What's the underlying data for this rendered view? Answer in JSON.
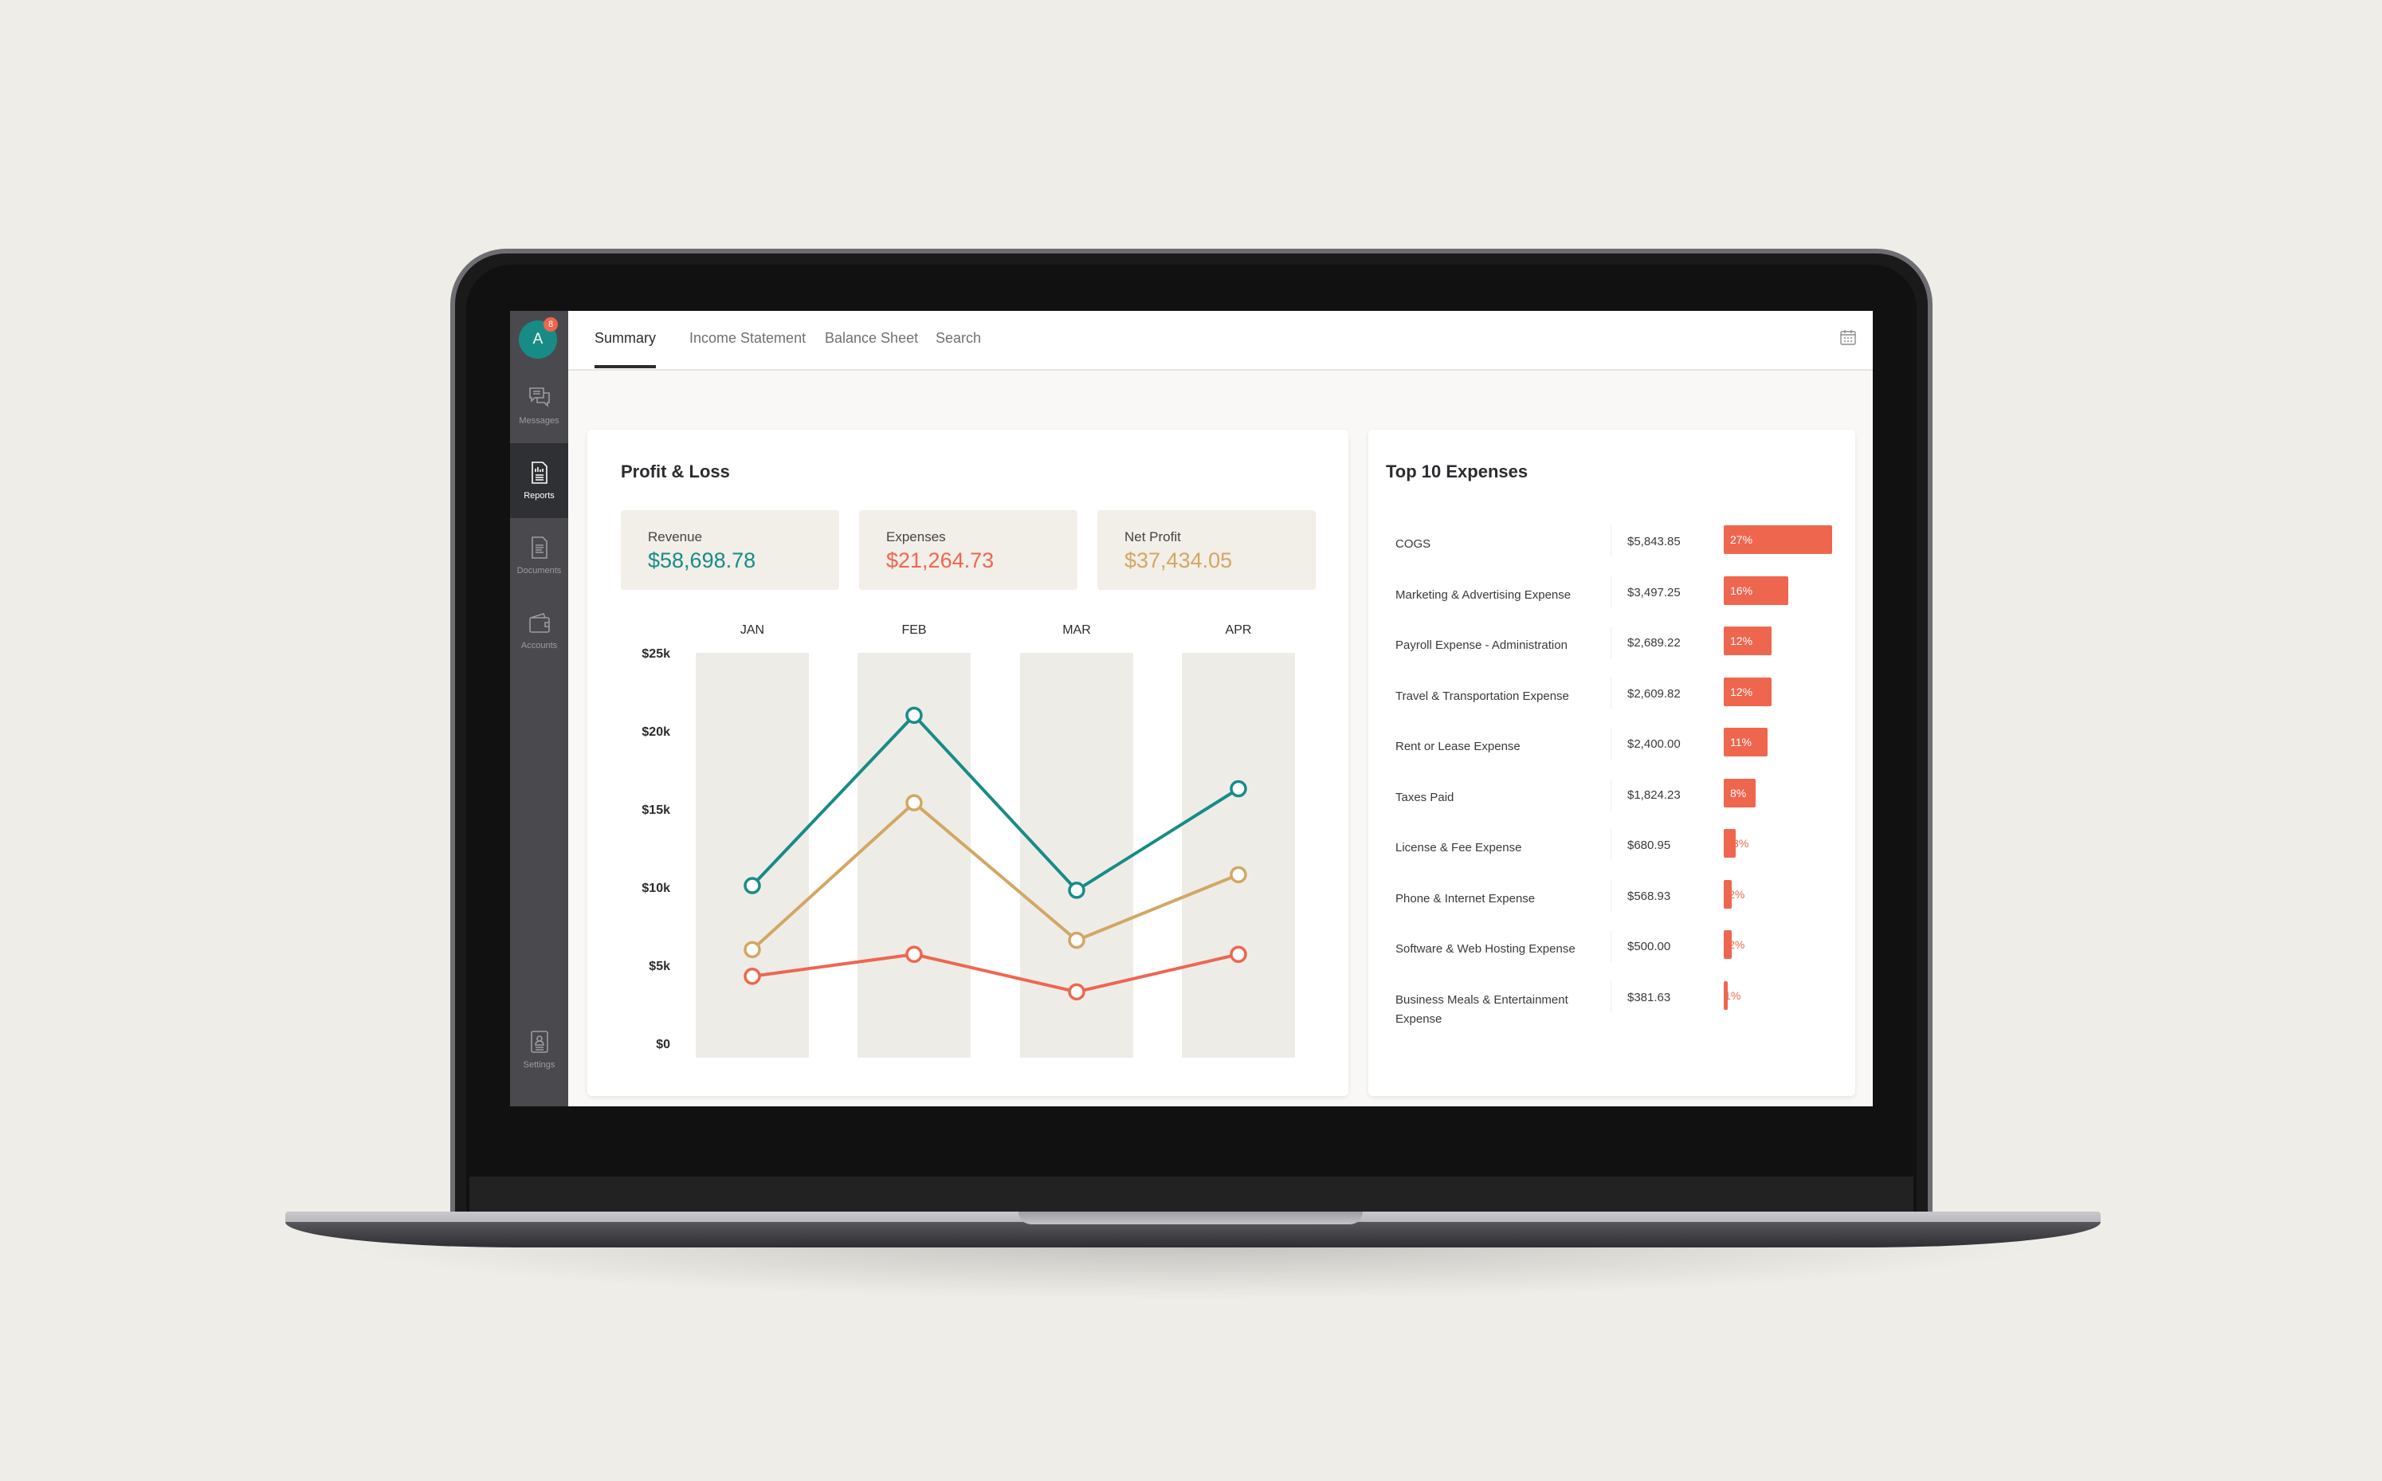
{
  "sidebar": {
    "avatar_initial": "A",
    "notification_count": "8",
    "items": [
      {
        "label": "Messages",
        "icon": "messages-icon"
      },
      {
        "label": "Reports",
        "icon": "reports-icon",
        "active": true
      },
      {
        "label": "Documents",
        "icon": "documents-icon"
      },
      {
        "label": "Accounts",
        "icon": "wallet-icon"
      },
      {
        "label": "Settings",
        "icon": "settings-icon"
      }
    ]
  },
  "tabs": [
    {
      "label": "Summary",
      "active": true
    },
    {
      "label": "Income Statement"
    },
    {
      "label": "Balance Sheet"
    },
    {
      "label": "Search"
    }
  ],
  "header_icon": "calendar-icon",
  "profit_loss": {
    "title": "Profit & Loss",
    "kpis": [
      {
        "label": "Revenue",
        "value": "$58,698.78",
        "color": "#178c87"
      },
      {
        "label": "Expenses",
        "value": "$21,264.73",
        "color": "#ef664f"
      },
      {
        "label": "Net Profit",
        "value": "$37,434.05",
        "color": "#d2a764"
      }
    ]
  },
  "chart_data": {
    "type": "line",
    "title": "Profit & Loss",
    "categories": [
      "JAN",
      "FEB",
      "MAR",
      "APR"
    ],
    "series": [
      {
        "name": "Revenue",
        "color": "#178c87",
        "values": [
          10100,
          21000,
          9800,
          16300
        ]
      },
      {
        "name": "Net Profit",
        "color": "#d2a764",
        "values": [
          6000,
          15400,
          6600,
          10800
        ]
      },
      {
        "name": "Expenses",
        "color": "#ef664f",
        "values": [
          4300,
          5700,
          3300,
          5700
        ]
      }
    ],
    "yticks": [
      "$0",
      "$5k",
      "$10k",
      "$15k",
      "$20k",
      "$25k"
    ],
    "ylim": [
      0,
      25000
    ],
    "xlabel": "",
    "ylabel": "",
    "grid": false,
    "legend": "none"
  },
  "top_expenses": {
    "title": "Top 10 Expenses",
    "items": [
      {
        "name": "COGS",
        "amount": "$5,843.85",
        "pct_label": "27%",
        "pct": 27
      },
      {
        "name": "Marketing & Advertising Expense",
        "amount": "$3,497.25",
        "pct_label": "16%",
        "pct": 16
      },
      {
        "name": "Payroll Expense - Administration",
        "amount": "$2,689.22",
        "pct_label": "12%",
        "pct": 12
      },
      {
        "name": "Travel & Transportation Expense",
        "amount": "$2,609.82",
        "pct_label": "12%",
        "pct": 12
      },
      {
        "name": "Rent or Lease Expense",
        "amount": "$2,400.00",
        "pct_label": "11%",
        "pct": 11
      },
      {
        "name": "Taxes Paid",
        "amount": "$1,824.23",
        "pct_label": "8%",
        "pct": 8
      },
      {
        "name": "License & Fee Expense",
        "amount": "$680.95",
        "pct_label": "3%",
        "pct": 3
      },
      {
        "name": "Phone & Internet Expense",
        "amount": "$568.93",
        "pct_label": "2%",
        "pct": 2
      },
      {
        "name": "Software & Web Hosting Expense",
        "amount": "$500.00",
        "pct_label": "2%",
        "pct": 2
      },
      {
        "name": "Business Meals & Entertainment Expense",
        "amount": "$381.63",
        "pct_label": "1%",
        "pct": 1
      }
    ]
  }
}
